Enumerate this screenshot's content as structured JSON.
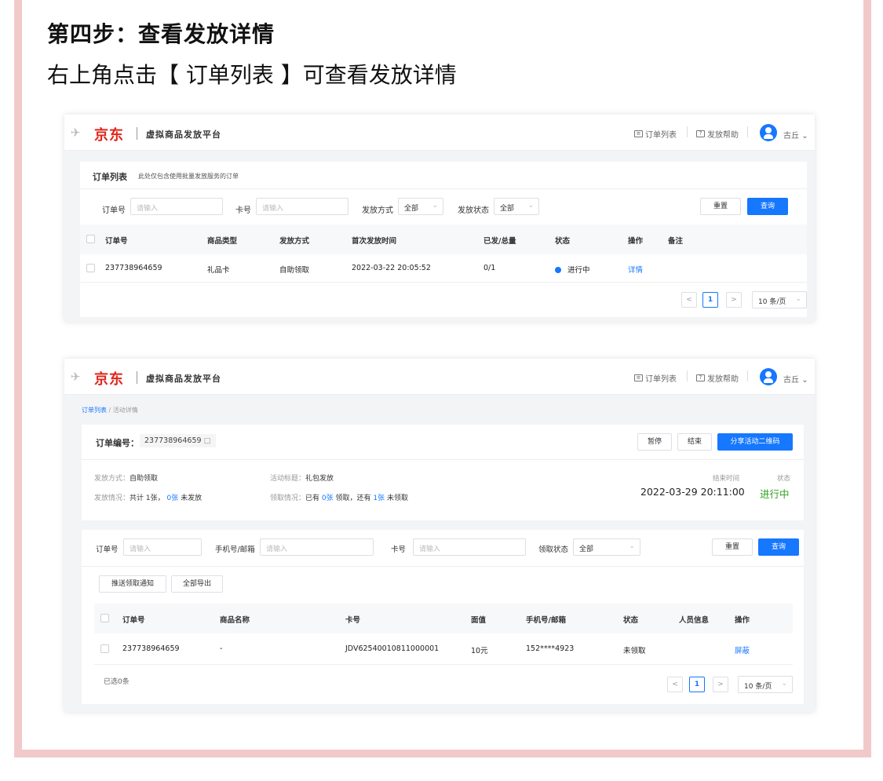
{
  "step": {
    "title": "第四步：查看发放详情",
    "description": "右上角点击【 订单列表 】可查看发放详情"
  },
  "header": {
    "logo_text": "京东",
    "platform_name": "虚拟商品发放平台",
    "nav_order_list": "订单列表",
    "nav_help": "发放帮助",
    "user_name": "古丘"
  },
  "order_list_page": {
    "title": "订单列表",
    "subtitle": "此处仅包含使用批量发放服务的订单",
    "filters": {
      "order_no_label": "订单号",
      "order_no_placeholder": "请输入",
      "card_no_label": "卡号",
      "card_no_placeholder": "请输入",
      "method_label": "发放方式",
      "method_value": "全部",
      "status_label": "发放状态",
      "status_value": "全部",
      "reset_label": "重置",
      "search_label": "查询"
    },
    "columns": [
      "订单号",
      "商品类型",
      "发放方式",
      "首次发放时间",
      "已发/总量",
      "状态",
      "操作",
      "备注"
    ],
    "rows": [
      {
        "order_no": "237738964659",
        "product_type": "礼品卡",
        "method": "自助领取",
        "first_time": "2022-03-22 20:05:52",
        "issued_total": "0/1",
        "status": "进行中",
        "action": "详情",
        "note": ""
      }
    ],
    "pager": {
      "prev": "<",
      "current": "1",
      "next": ">",
      "page_size": "10 条/页"
    }
  },
  "detail_page": {
    "breadcrumb_root": "订单列表",
    "breadcrumb_sep": "/",
    "breadcrumb_current": "活动详情",
    "order_label": "订单编号：",
    "order_no": "237738964659",
    "copy_icon": "□",
    "pause_label": "暂停",
    "end_label": "结束",
    "share_label": "分享活动二维码",
    "info": {
      "method_key": "发放方式：",
      "method_value": "自助领取",
      "activity_key": "活动标题：",
      "activity_value": "礼包发放",
      "issue_key": "发放情况：",
      "issue_p1": "共计 1张，",
      "issue_count": "0张",
      "issue_p2": "未发放",
      "claim_key": "领取情况：",
      "claim_p1": "已有",
      "claim_count1": "0张",
      "claim_p2": "领取，还有",
      "claim_count2": "1张",
      "claim_p3": "未领取",
      "end_time_key": "结束时间",
      "end_time_value": "2022-03-29 20:11:00",
      "status_key": "状态",
      "status_value": "进行中"
    },
    "filters": {
      "order_no_label": "订单号",
      "order_no_placeholder": "请输入",
      "phone_label": "手机号/邮箱",
      "phone_placeholder": "请输入",
      "card_label": "卡号",
      "card_placeholder": "请输入",
      "claim_status_label": "领取状态",
      "claim_status_value": "全部",
      "reset_label": "重置",
      "search_label": "查询"
    },
    "push_label": "推送领取通知",
    "export_label": "全部导出",
    "columns": [
      "订单号",
      "商品名称",
      "卡号",
      "面值",
      "手机号/邮箱",
      "状态",
      "人员信息",
      "操作"
    ],
    "rows": [
      {
        "order_no": "237738964659",
        "product_name": "-",
        "card_no": "JDV62540010811000001",
        "value": "10元",
        "phone": "152****4923",
        "status": "未领取",
        "person": "",
        "action": "屏蔽"
      }
    ],
    "selected_text": "已选0条",
    "pager": {
      "prev": "<",
      "current": "1",
      "next": ">",
      "page_size": "10 条/页"
    }
  },
  "colors": {
    "frame": "#f2c9c9",
    "accent": "#1677ff",
    "brand_red": "#e1251b",
    "status_green": "#2ea121"
  }
}
